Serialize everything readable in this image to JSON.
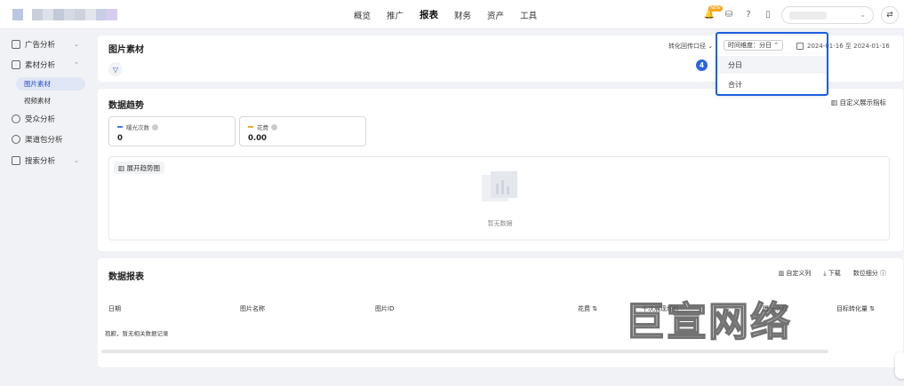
{
  "nav": {
    "items": [
      "概览",
      "推广",
      "报表",
      "财务",
      "资产",
      "工具"
    ],
    "active": "报表"
  },
  "topbar": {
    "badge": "NEW"
  },
  "sidebar": {
    "items": [
      "广告分析",
      "素材分析",
      "受众分析",
      "渠道包分析",
      "搜索分析"
    ],
    "subitems": [
      "图片素材",
      "视频素材"
    ]
  },
  "filter_panel": {
    "title": "图片素材",
    "conversion_select": "转化回传口径",
    "time_dim_label": "时间维度：分日",
    "date_range": "2024-01-16 至 2024-01-16",
    "step_badge": "4",
    "dropdown_options": [
      "分日",
      "合计"
    ]
  },
  "trend": {
    "title": "数据趋势",
    "custom_metric": "自定义展示指标",
    "metrics": [
      {
        "label": "曝光次数",
        "value": "0",
        "color": "#4a78e6"
      },
      {
        "label": "花费",
        "value": "0.00",
        "color": "#f5a623"
      }
    ],
    "expand_btn": "展开趋势图",
    "empty_text": "暂无数据"
  },
  "report": {
    "title": "数据报表",
    "actions": [
      "自定义列",
      "下载",
      "数位细分"
    ],
    "columns": [
      "日期",
      "图片名称",
      "图片ID",
      "花费",
      "千次展现均价",
      "曝光次数",
      "目标转化量"
    ],
    "empty_row": "抱歉，暂无相关数据记录"
  },
  "watermark": "巨宣网络"
}
